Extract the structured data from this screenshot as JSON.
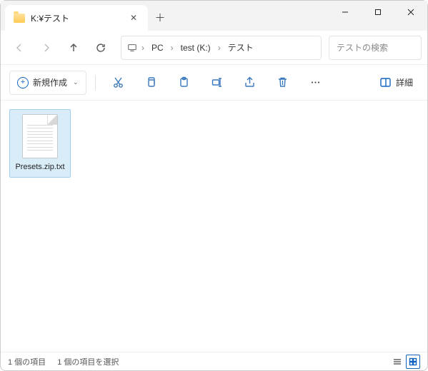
{
  "tab": {
    "title": "K:¥テスト"
  },
  "breadcrumb": {
    "items": [
      "PC",
      "test (K:)",
      "テスト"
    ]
  },
  "search": {
    "placeholder": "テストの検索"
  },
  "toolbar": {
    "new_label": "新規作成",
    "details_label": "詳細"
  },
  "files": [
    {
      "name": "Presets.zip.txt"
    }
  ],
  "status": {
    "count": "1 個の項目",
    "selected": "1 個の項目を選択"
  }
}
